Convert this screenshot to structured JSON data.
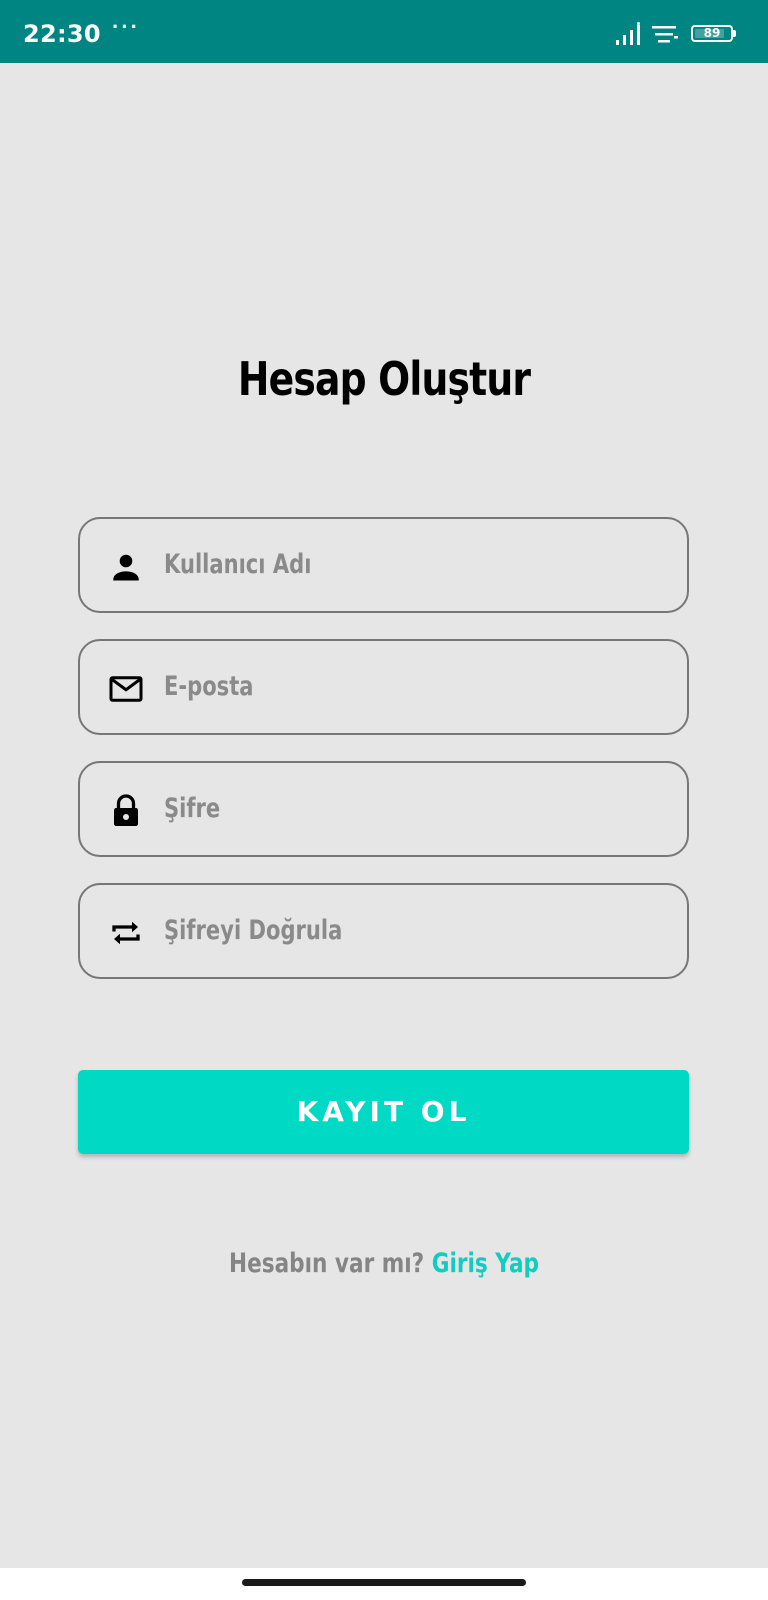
{
  "status_bar": {
    "time": "22:30",
    "dots": "···",
    "battery": "89",
    "icons": [
      "signal-icon",
      "wifi-icon",
      "battery-icon"
    ]
  },
  "title": "Hesap Oluştur",
  "form": {
    "username": {
      "placeholder": "Kullanıcı Adı",
      "icon": "person-icon"
    },
    "email": {
      "placeholder": "E-posta",
      "icon": "mail-icon"
    },
    "password": {
      "placeholder": "Şifre",
      "icon": "lock-icon"
    },
    "confirm_password": {
      "placeholder": "Şifreyi Doğrula",
      "icon": "repeat-icon"
    }
  },
  "register_button": "KAYIT OL",
  "login_prompt": {
    "question": "Hesabın var mı?",
    "link": "Giriş Yap"
  },
  "colors": {
    "status_bar": "#008582",
    "background": "#e6e6e6",
    "accent": "#00d9c4",
    "link": "#12ccc0"
  }
}
